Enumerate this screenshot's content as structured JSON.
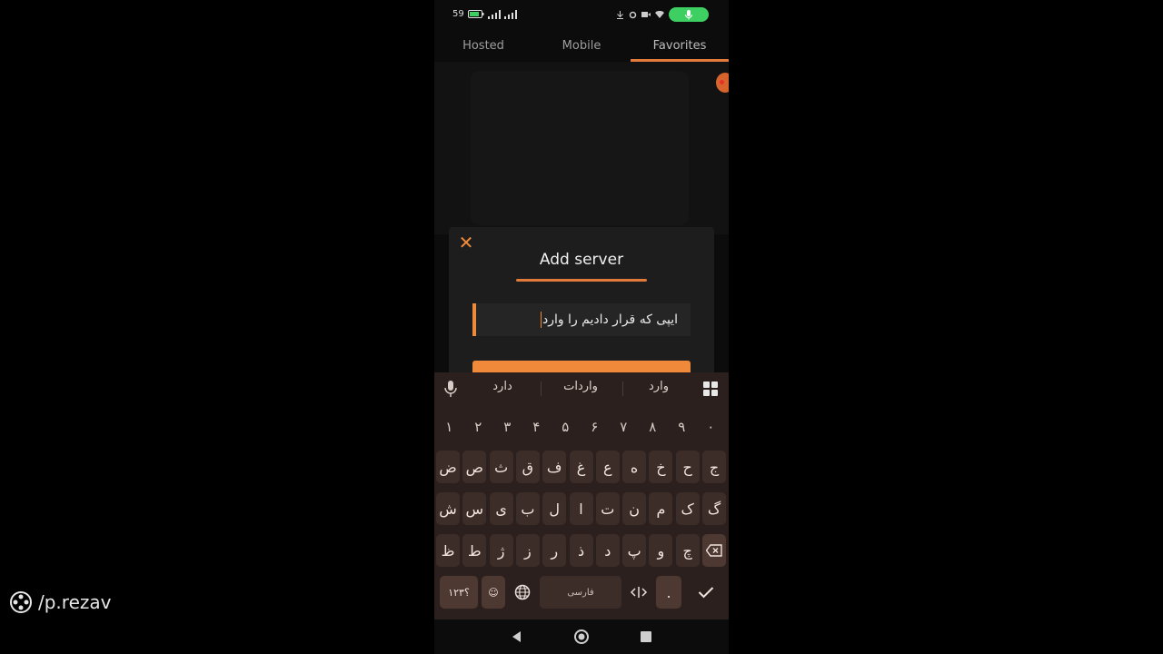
{
  "watermark": {
    "handle": "/p.rezav"
  },
  "statusbar": {
    "time": "59"
  },
  "tabs": [
    {
      "label": "Hosted"
    },
    {
      "label": "Mobile"
    },
    {
      "label": "Favorites"
    }
  ],
  "dialog": {
    "title": "Add server",
    "input_value": "ایپی که قرار دادیم را وارد"
  },
  "keyboard": {
    "suggestions": [
      "دارد",
      "واردات",
      "وارد"
    ],
    "row_numbers": [
      "۱",
      "۲",
      "۳",
      "۴",
      "۵",
      "۶",
      "۷",
      "۸",
      "۹",
      "۰"
    ],
    "row1": [
      "ض",
      "ص",
      "ث",
      "ق",
      "ف",
      "غ",
      "ع",
      "ه",
      "خ",
      "ح",
      "ج"
    ],
    "row2": [
      "ش",
      "س",
      "ی",
      "ب",
      "ل",
      "ا",
      "ت",
      "ن",
      "م",
      "ک",
      "گ"
    ],
    "row3": [
      "ظ",
      "ط",
      "ژ",
      "ز",
      "ر",
      "ذ",
      "د",
      "پ",
      "و",
      "چ"
    ],
    "symbols_label": "؟۱۲۳",
    "space_label": "فارسی",
    "period_label": "."
  },
  "colors": {
    "accent": "#f08a3a",
    "keyboard_bg": "#2b201d",
    "key_bg": "#3d2d28"
  }
}
